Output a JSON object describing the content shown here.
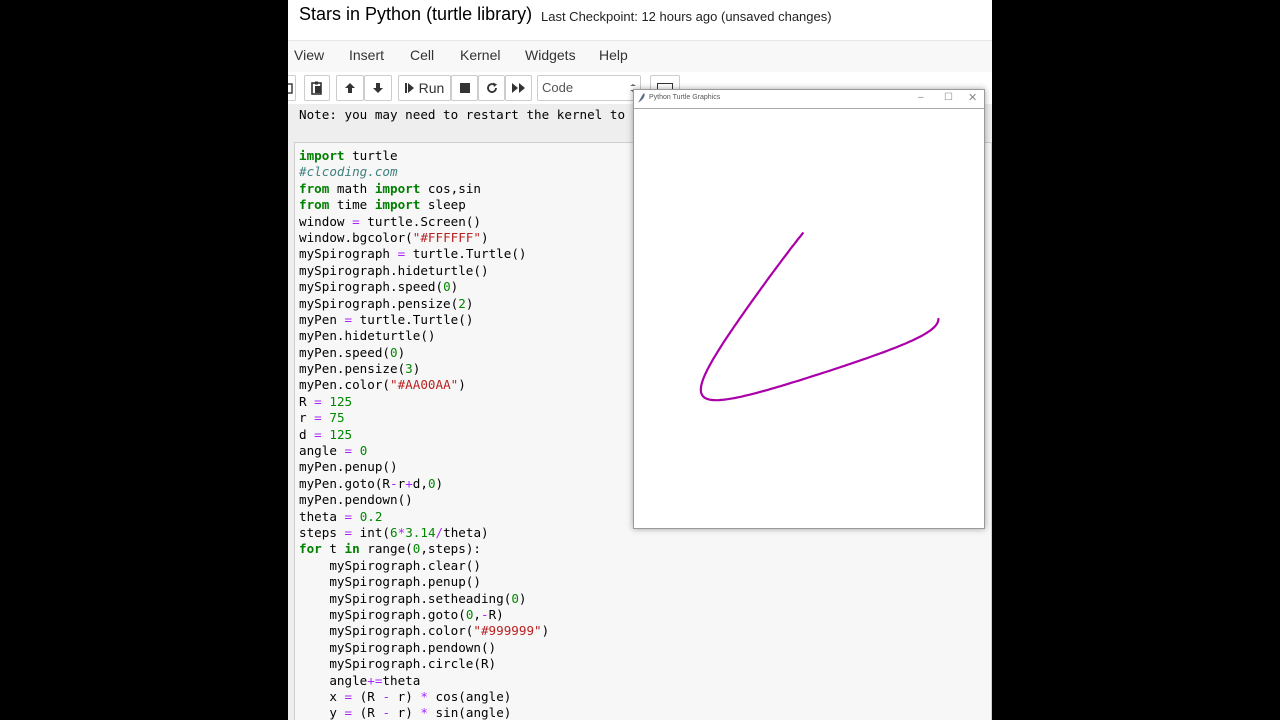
{
  "header": {
    "title": "Stars in Python (turtle library)",
    "checkpoint": "Last Checkpoint: 12 hours ago",
    "unsaved": "(unsaved changes)"
  },
  "menu": [
    "View",
    "Insert",
    "Cell",
    "Kernel",
    "Widgets",
    "Help"
  ],
  "toolbar": {
    "run_label": "Run",
    "cell_type": "Code"
  },
  "notebook": {
    "note": "Note: you may need to restart the kernel to u",
    "code_lines": [
      "import turtle",
      "#clcoding.com",
      "from math import cos,sin",
      "from time import sleep",
      "window = turtle.Screen()",
      "window.bgcolor(\"#FFFFFF\")",
      "mySpirograph = turtle.Turtle()",
      "mySpirograph.hideturtle()",
      "mySpirograph.speed(0)",
      "mySpirograph.pensize(2)",
      "myPen = turtle.Turtle()",
      "myPen.hideturtle()",
      "myPen.speed(0)",
      "myPen.pensize(3)",
      "myPen.color(\"#AA00AA\")",
      "R = 125",
      "r = 75",
      "d = 125",
      "angle = 0",
      "myPen.penup()",
      "myPen.goto(R-r+d,0)",
      "myPen.pendown()",
      "theta = 0.2",
      "steps = int(6*3.14/theta)",
      "for t in range(0,steps):",
      "    mySpirograph.clear()",
      "    mySpirograph.penup()",
      "    mySpirograph.setheading(0)",
      "    mySpirograph.goto(0,-R)",
      "    mySpirograph.color(\"#999999\")",
      "    mySpirograph.pendown()",
      "    mySpirograph.circle(R)",
      "    angle+=theta",
      "    x = (R - r) * cos(angle)",
      "    y = (R - r) * sin(angle)"
    ]
  },
  "turtle_window": {
    "title": "Python Turtle Graphics",
    "pen_color": "#AA00AA",
    "bg_color": "#FFFFFF"
  },
  "colors": {
    "keyword": "#008000",
    "comment": "#408080",
    "string": "#BA2121",
    "number": "#008800",
    "operator": "#AA22FF"
  }
}
